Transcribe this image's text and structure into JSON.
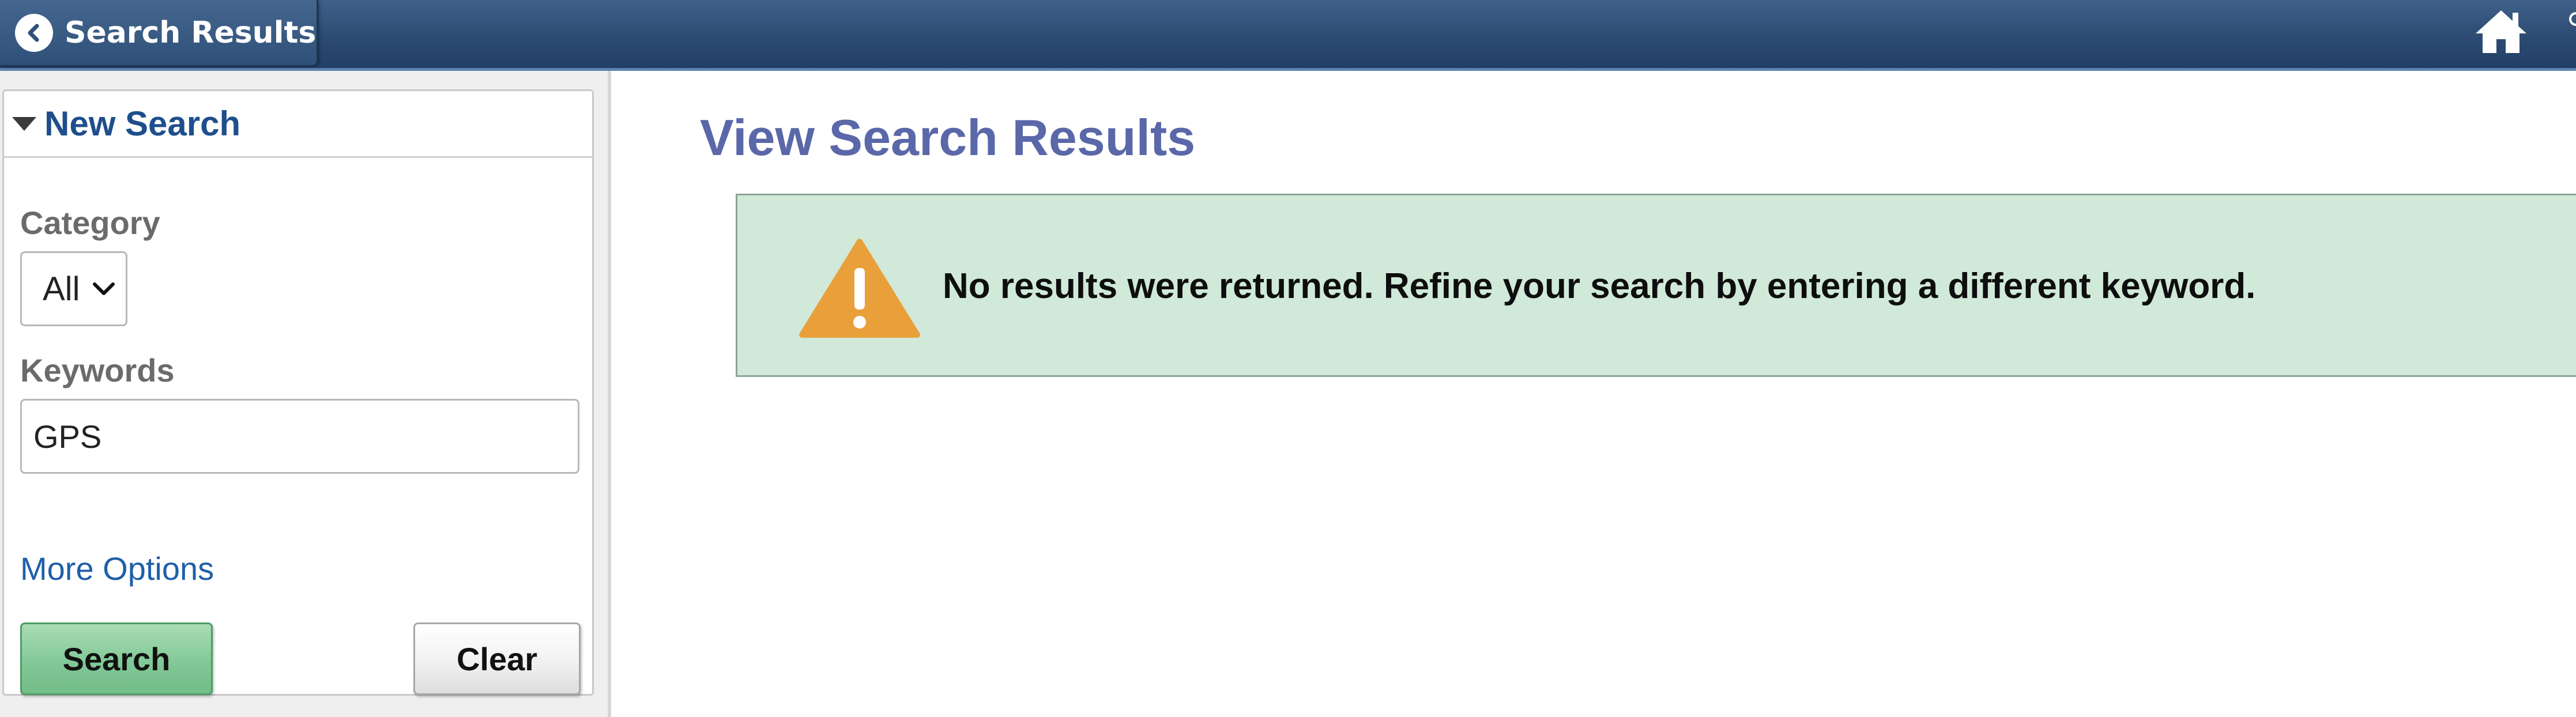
{
  "header": {
    "back_title": "Search Results",
    "back_icon": "chevron-left-icon",
    "home_icon": "home-icon",
    "bar_color": "#2c4b73"
  },
  "search_panel": {
    "title": "New Search",
    "category_label": "Category",
    "category_selected": "All",
    "keywords_label": "Keywords",
    "keywords_value": "GPS",
    "more_options_label": "More Options",
    "search_button_label": "Search",
    "clear_button_label": "Clear"
  },
  "main": {
    "page_title": "View Search Results",
    "message": "No results were returned. Refine your search by entering a different keyword.",
    "message_icon": "warning-icon",
    "message_background": "#d0e9d8",
    "warning_color": "#e9a03b"
  }
}
